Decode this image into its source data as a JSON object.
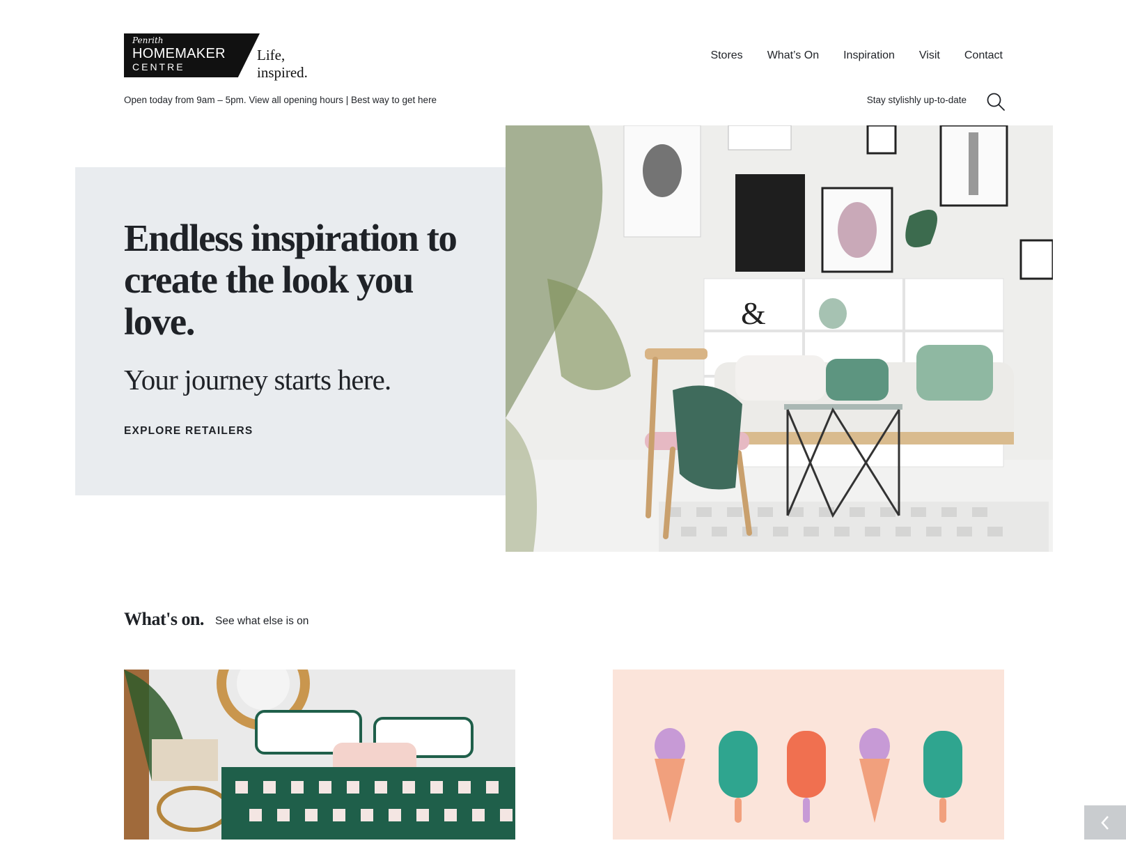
{
  "logo": {
    "script_text": "Penrith",
    "main_text": "HOMEMAKER",
    "sub_text": "CENTRE",
    "tagline": "Life, inspired."
  },
  "nav": {
    "items": [
      {
        "label": "Stores"
      },
      {
        "label": "What’s On"
      },
      {
        "label": "Inspiration"
      },
      {
        "label": "Visit"
      },
      {
        "label": "Contact"
      }
    ]
  },
  "subheader": {
    "hours_text": "Open today from 9am – 5pm.",
    "hours_link": "View all opening hours",
    "separator": "|",
    "directions_link": "Best way to get here",
    "newsletter_link": "Stay stylishly up-to-date"
  },
  "icons": {
    "search": "search-icon",
    "back": "chevron-left-icon"
  },
  "hero": {
    "title": "Endless inspiration to create the look you love.",
    "subtitle": "Your journey starts here.",
    "cta": "EXPLORE RETAILERS"
  },
  "whats_on": {
    "title": "What's on.",
    "link": "See what else is on"
  },
  "colors": {
    "text": "#1f2227",
    "hero_panel": "#e9ecef",
    "card_peach": "#fbe4da",
    "logo_bg": "#111111"
  }
}
